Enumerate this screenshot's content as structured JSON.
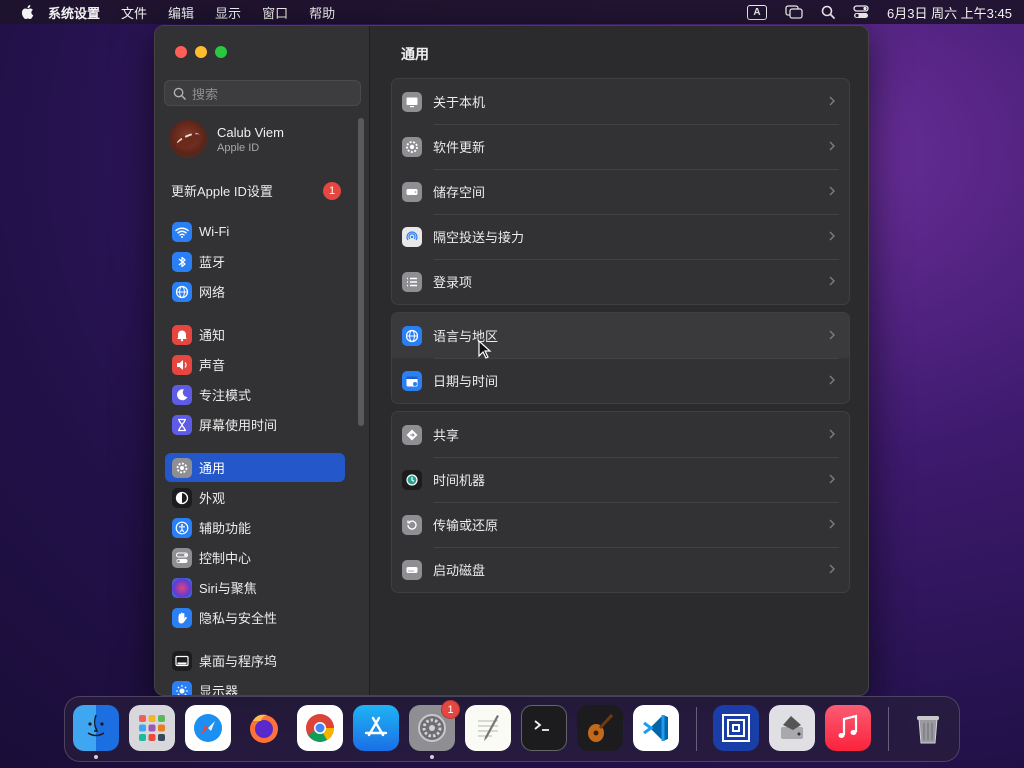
{
  "menubar": {
    "app_name": "系统设置",
    "menus": [
      "文件",
      "编辑",
      "显示",
      "窗口",
      "帮助"
    ],
    "input_source": "A",
    "datetime": "6月3日 周六 上午3:45"
  },
  "window": {
    "search": {
      "placeholder": "搜索"
    },
    "profile": {
      "name": "Calub Viem",
      "subtitle": "Apple ID"
    },
    "update_apple_id": {
      "label": "更新Apple ID设置",
      "badge": "1"
    },
    "sidebar_items": [
      {
        "label": "Wi-Fi",
        "icon": "wifi-icon",
        "color": "#2a7ff5"
      },
      {
        "label": "蓝牙",
        "icon": "bluetooth-icon",
        "color": "#2a7ff5"
      },
      {
        "label": "网络",
        "icon": "globe-icon",
        "color": "#2a7ff5"
      },
      {
        "label": "通知",
        "icon": "bell-icon",
        "color": "#e5463f"
      },
      {
        "label": "声音",
        "icon": "speaker-icon",
        "color": "#e5463f"
      },
      {
        "label": "专注模式",
        "icon": "moon-icon",
        "color": "#5e5ce6"
      },
      {
        "label": "屏幕使用时间",
        "icon": "hourglass-icon",
        "color": "#5e5ce6"
      },
      {
        "label": "通用",
        "icon": "gear-icon",
        "color": "#8e8e93",
        "active": true
      },
      {
        "label": "外观",
        "icon": "appearance-icon",
        "color": "#1c1c1e"
      },
      {
        "label": "辅助功能",
        "icon": "accessibility-icon",
        "color": "#2a7ff5"
      },
      {
        "label": "控制中心",
        "icon": "toggles-icon",
        "color": "#8e8e93"
      },
      {
        "label": "Siri与聚焦",
        "icon": "siri-icon",
        "color": "#8a3ac7"
      },
      {
        "label": "隐私与安全性",
        "icon": "hand-icon",
        "color": "#2a7ff5"
      },
      {
        "label": "桌面与程序坞",
        "icon": "dock-icon",
        "color": "#1c1c1e"
      },
      {
        "label": "显示器",
        "icon": "sun-icon",
        "color": "#2a7ff5"
      }
    ],
    "content_title": "通用",
    "groups": [
      [
        {
          "label": "关于本机",
          "icon": "computer-icon"
        },
        {
          "label": "软件更新",
          "icon": "gear-update-icon"
        },
        {
          "label": "储存空间",
          "icon": "drive-icon"
        },
        {
          "label": "隔空投送与接力",
          "icon": "airdrop-icon"
        },
        {
          "label": "登录项",
          "icon": "list-icon"
        }
      ],
      [
        {
          "label": "语言与地区",
          "icon": "globe-icon"
        },
        {
          "label": "日期与时间",
          "icon": "calendar-icon"
        }
      ],
      [
        {
          "label": "共享",
          "icon": "share-icon"
        },
        {
          "label": "时间机器",
          "icon": "time-machine-icon"
        },
        {
          "label": "传输或还原",
          "icon": "restore-icon"
        },
        {
          "label": "启动磁盘",
          "icon": "disk-icon"
        }
      ]
    ]
  },
  "dock": {
    "apps": [
      {
        "name": "Finder",
        "icon": "finder-icon"
      },
      {
        "name": "Launchpad",
        "icon": "launchpad-icon"
      },
      {
        "name": "Safari",
        "icon": "safari-icon"
      },
      {
        "name": "Firefox",
        "icon": "firefox-icon"
      },
      {
        "name": "Chrome",
        "icon": "chrome-icon"
      },
      {
        "name": "App Store",
        "icon": "appstore-icon"
      },
      {
        "name": "System Settings",
        "icon": "settings-icon",
        "badge": "1"
      },
      {
        "name": "TextEdit",
        "icon": "textedit-icon"
      },
      {
        "name": "Terminal",
        "icon": "terminal-icon"
      },
      {
        "name": "GarageBand",
        "icon": "guitar-icon"
      },
      {
        "name": "VS Code",
        "icon": "vscode-icon"
      },
      {
        "name": "Screen Recorder",
        "icon": "concentric-squares-icon"
      },
      {
        "name": "Disk Utility",
        "icon": "disk-utility-icon"
      },
      {
        "name": "Music",
        "icon": "music-icon"
      },
      {
        "name": "Trash",
        "icon": "trash-icon"
      }
    ]
  }
}
